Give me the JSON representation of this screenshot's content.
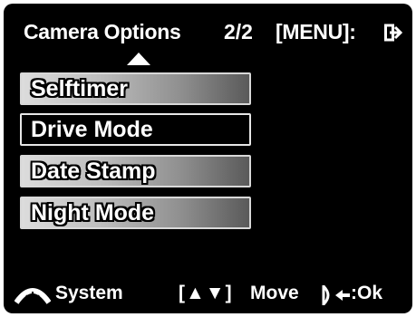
{
  "header": {
    "title": "Camera Options",
    "page": "2/2",
    "menu_label": "[MENU]:",
    "exit_icon": "exit-arrow-icon"
  },
  "menu": {
    "items": [
      {
        "label": "Selftimer",
        "selected": false
      },
      {
        "label": "Drive Mode",
        "selected": true
      },
      {
        "label": "Date Stamp",
        "selected": false
      },
      {
        "label": "Night Mode",
        "selected": false
      }
    ]
  },
  "footer": {
    "system_label": "System",
    "move_brackets_label": "[▲▼]",
    "move_label": "Move",
    "ok_label": ":Ok"
  },
  "colors": {
    "background": "#000000",
    "text": "#ffffff",
    "item_gradient_light": "#dcdcdc",
    "item_gradient_dark": "#5a5a5a"
  }
}
